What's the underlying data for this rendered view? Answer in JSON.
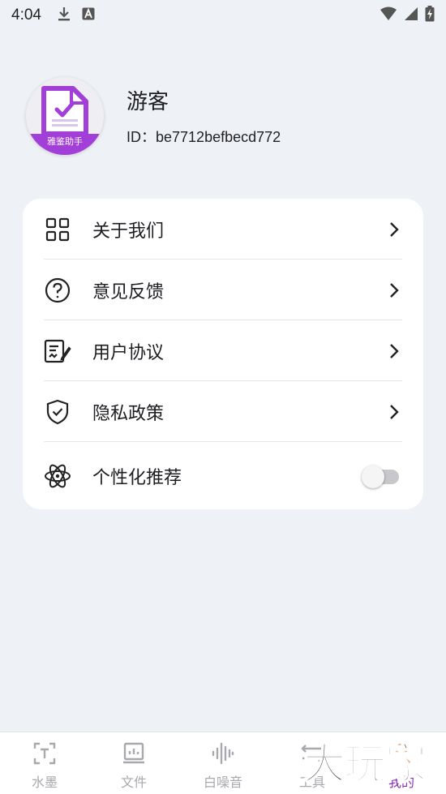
{
  "status_bar": {
    "time": "4:04",
    "left_icons": [
      "download-icon",
      "text-a-icon"
    ],
    "right_icons": [
      "wifi-icon",
      "signal-icon",
      "battery-charging-icon"
    ]
  },
  "profile": {
    "name": "游客",
    "id_text": "ID：be7712befbecd772",
    "avatar_ribbon": "雅鉴助手"
  },
  "menu": {
    "items": [
      {
        "label": "关于我们",
        "icon": "grid-icon"
      },
      {
        "label": "意见反馈",
        "icon": "question-circle-icon"
      },
      {
        "label": "用户协议",
        "icon": "document-edit-icon"
      },
      {
        "label": "隐私政策",
        "icon": "shield-check-icon"
      },
      {
        "label": "个性化推荐",
        "icon": "atom-icon",
        "toggle": false
      }
    ]
  },
  "bottom_nav": {
    "tabs": [
      {
        "label": "水墨",
        "icon": "text-box-icon"
      },
      {
        "label": "文件",
        "icon": "file-chart-icon"
      },
      {
        "label": "白噪音",
        "icon": "sound-wave-icon"
      },
      {
        "label": "工具",
        "icon": "tools-icon"
      },
      {
        "label": "我的",
        "icon": "profile-icon",
        "active": true
      }
    ]
  },
  "watermark": "大玩家",
  "colors": {
    "background": "#eef1f6",
    "accent": "#a23fd8",
    "active_tab": "#8a2bb8"
  }
}
